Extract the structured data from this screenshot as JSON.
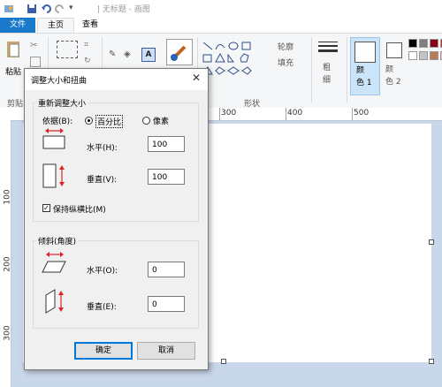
{
  "titlebar": {
    "title": "| 无标题 - 画图"
  },
  "tabs": {
    "file": "文件",
    "home": "主页",
    "view": "查看"
  },
  "ribbon": {
    "paste": "粘贴",
    "clipboard_group": "剪贴",
    "thickness": "粗\n细",
    "color1": "颜\n色 1",
    "color2": "颜\n色 2",
    "outline": "轮廓",
    "fill": "填充",
    "shapes_group": "形状",
    "text_tool": "A"
  },
  "ruler": {
    "ticks": [
      "300",
      "400",
      "500"
    ],
    "vticks": [
      "100",
      "200",
      "300"
    ]
  },
  "dialog": {
    "title": "调整大小和扭曲",
    "close": "✕",
    "resize_group": "重新调整大小",
    "by_label": "依据(B):",
    "percent_label": "百分比",
    "pixels_label": "像素",
    "h_label": "水平(H):",
    "h_value": "100",
    "v_label": "垂直(V):",
    "v_value": "100",
    "keep_ratio": "保持纵横比(M)",
    "skew_group": "倾斜(角度)",
    "skew_h_label": "水平(O):",
    "skew_h_value": "0",
    "skew_v_label": "垂直(E):",
    "skew_v_value": "0",
    "ok": "确定",
    "cancel": "取消"
  },
  "colors": {
    "accent": "#1979ca",
    "arrow_red": "#d9252b",
    "palette": [
      "#000000",
      "#7f7f7f",
      "#880015",
      "#ed1c24",
      "#ffffff",
      "#c3c3c3",
      "#b97a57",
      "#ffaec9"
    ]
  }
}
